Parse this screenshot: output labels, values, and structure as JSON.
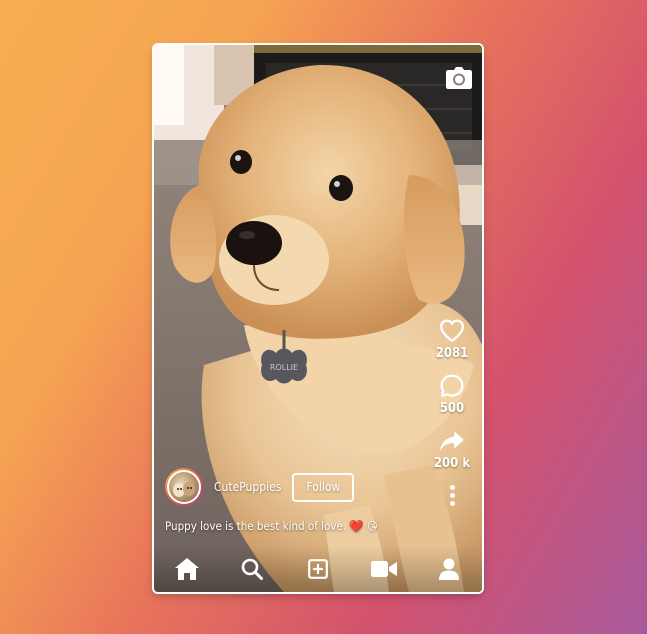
{
  "reel": {
    "username": "CutePuppies",
    "follow_label": "Follow",
    "caption": "Puppy love is the best kind of love. ❤️ 😘",
    "likes": "2081",
    "comments": "500",
    "shares": "200 k"
  },
  "icons": {
    "camera": "camera-icon",
    "like": "heart-icon",
    "comment": "comment-icon",
    "share": "share-icon",
    "more": "more-vertical-icon",
    "home": "home-icon",
    "search": "search-icon",
    "create": "plus-square-icon",
    "reels": "video-icon",
    "profile": "user-icon"
  },
  "colors": {
    "gradient_start": "#f9ae51",
    "gradient_end": "#a85a9c",
    "icon_color": "#ffffff"
  }
}
